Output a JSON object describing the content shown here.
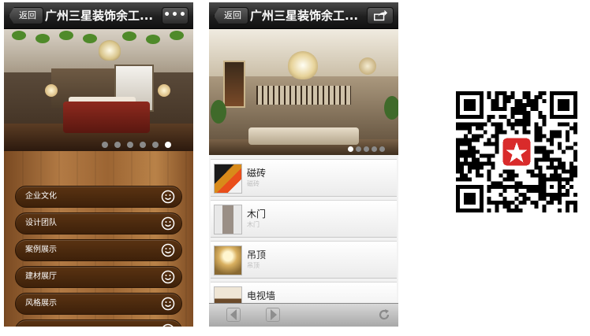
{
  "left_phone": {
    "back_label": "返回",
    "title": "广州三星装饰余工...",
    "more_icon": "more-dots-icon",
    "banner_dots_total": 6,
    "banner_active_dot": 6,
    "menu": [
      {
        "label": "企业文化",
        "icon": "smiley-icon"
      },
      {
        "label": "设计团队",
        "icon": "smiley-icon"
      },
      {
        "label": "案例展示",
        "icon": "smiley-icon"
      },
      {
        "label": "建材展厅",
        "icon": "smiley-icon"
      },
      {
        "label": "风格展示",
        "icon": "smiley-icon"
      },
      {
        "label": "",
        "icon": "smiley-icon"
      }
    ]
  },
  "right_phone": {
    "back_label": "返回",
    "title": "广州三星装饰余工...",
    "share_icon": "share-icon",
    "banner_dots_total": 5,
    "banner_active_dot": 1,
    "categories": [
      {
        "name": "磁砖",
        "sub": "磁砖"
      },
      {
        "name": "木门",
        "sub": "木门"
      },
      {
        "name": "吊顶",
        "sub": "吊顶"
      },
      {
        "name": "电视墙",
        "sub": ""
      }
    ],
    "toolbar": {
      "back_icon": "arrow-left-icon",
      "forward_icon": "arrow-right-icon",
      "refresh_icon": "refresh-icon"
    }
  },
  "qr_code": {
    "logo_icon": "red-star-logo-icon"
  },
  "colors": {
    "wood": "#9c6533",
    "menu_pill": "#4a280c",
    "qr_logo": "#d92b2b"
  }
}
